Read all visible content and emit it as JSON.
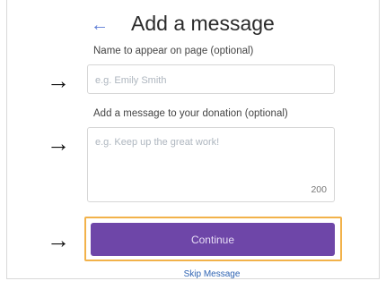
{
  "header": {
    "back_icon": "←",
    "title": "Add a message"
  },
  "name_section": {
    "label": "Name to appear on page (optional)",
    "placeholder": "e.g. Emily Smith",
    "value": ""
  },
  "message_section": {
    "label": "Add a message to your donation (optional)",
    "placeholder": "e.g. Keep up the great work!",
    "value": "",
    "char_count": "200"
  },
  "annotations": {
    "arrow_icon": "→",
    "highlight_color": "#f2b24a"
  },
  "actions": {
    "continue_label": "Continue",
    "continue_color": "#6e46a8",
    "skip_label": "Skip Message"
  }
}
